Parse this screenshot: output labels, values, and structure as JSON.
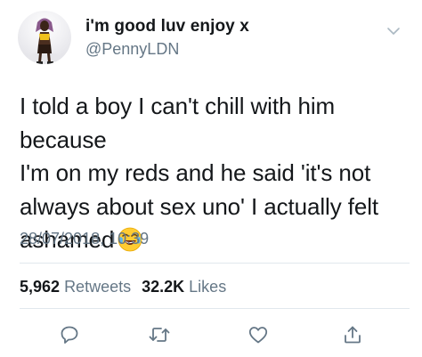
{
  "tweet": {
    "author": {
      "display_name": "i'm good luv enjoy x",
      "handle": "@PennyLDN"
    },
    "text_lines": [
      "I told a boy I can't chill with him because",
      "I'm on my reds and he said 'it's not",
      "always about sex uno' I actually felt",
      "ashamed"
    ],
    "timestamp": "28/07/2018, 10:39",
    "stats": {
      "retweets_count": "5,962",
      "retweets_label": "Retweets",
      "likes_count": "32.2K",
      "likes_label": "Likes"
    }
  },
  "icons": {
    "menu": "chevron-down-icon",
    "emoji": "face-with-tears-of-joy-icon",
    "reply": "reply-icon",
    "retweet": "retweet-icon",
    "like": "heart-icon",
    "share": "share-icon"
  },
  "colors": {
    "text": "#14171a",
    "secondary": "#657786",
    "divider": "#e1e8ed"
  }
}
